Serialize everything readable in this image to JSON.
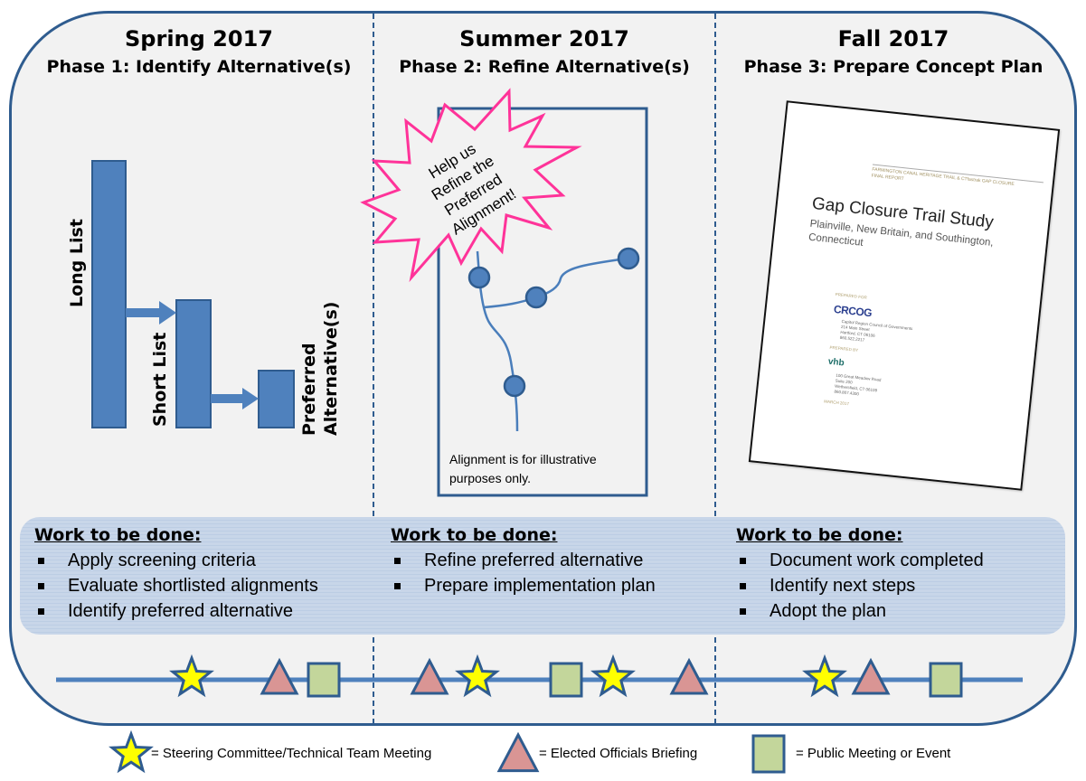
{
  "columns": [
    {
      "season": "Spring 2017",
      "phase": "Phase 1: Identify Alternative(s)"
    },
    {
      "season": "Summer 2017",
      "phase": "Phase 2: Refine Alternative(s)"
    },
    {
      "season": "Fall 2017",
      "phase": "Phase 3: Prepare Concept Plan"
    }
  ],
  "phase1_funnel": {
    "labels": [
      "Long List",
      "Short List",
      "Preferred",
      "Alternative(s)"
    ]
  },
  "phase2_map": {
    "callout_lines": [
      "Help us",
      "Refine the",
      "Preferred",
      "Alignment!"
    ],
    "note": "Alignment is for illustrative purposes only."
  },
  "phase3_document": {
    "header_line1": "FARMINGTON CANAL HERITAGE TRAIL & CTfastrak GAP CLOSURE",
    "header_line2": "FINAL REPORT",
    "title": "Gap Closure Trail Study",
    "subtitle": "Plainville, New Britain, and Southington, Connecticut",
    "prepared_for_label": "PREPARED FOR",
    "prepared_for_logo": "CRCOG",
    "prepared_for_address": [
      "Capitol Region Council of Governments",
      "214 Main Street",
      "Hartford, CT 06106",
      "860.522.2217"
    ],
    "prepared_by_label": "PREPARED BY",
    "prepared_by_logo": "vhb",
    "prepared_by_address": [
      "100 Great Meadow Road",
      "Suite 200",
      "Wethersfield, CT 06109",
      "860.807.4300"
    ],
    "date": "MARCH 2017"
  },
  "work": {
    "title": "Work to be done:",
    "columns": [
      [
        "Apply screening criteria",
        "Evaluate shortlisted alignments",
        "Identify preferred alternative"
      ],
      [
        "Refine preferred alternative",
        "Prepare implementation plan"
      ],
      [
        "Document work completed",
        "Identify next steps",
        "Adopt the plan"
      ]
    ]
  },
  "timeline": {
    "events_in_order": [
      "star",
      "triangle",
      "square",
      "triangle",
      "star",
      "square",
      "star",
      "triangle",
      "star",
      "triangle",
      "square"
    ],
    "by_phase": {
      "spring": [
        "star",
        "triangle",
        "square"
      ],
      "summer": [
        "triangle",
        "star",
        "square",
        "star",
        "triangle"
      ],
      "fall": [
        "star",
        "triangle",
        "square"
      ]
    }
  },
  "legend": {
    "star": "= Steering Committee/Technical Team Meeting",
    "triangle": "= Elected Officials Briefing",
    "square": "= Public Meeting or Event"
  },
  "colors": {
    "frame": "#2f5c8f",
    "bar_fill": "#4f81bd",
    "star_fill": "#ffff00",
    "triangle_fill": "#d99594",
    "square_fill": "#c3d69b",
    "callout": "#ff3399",
    "work_band": "#c8d6e9",
    "background": "#f2f2f2"
  }
}
